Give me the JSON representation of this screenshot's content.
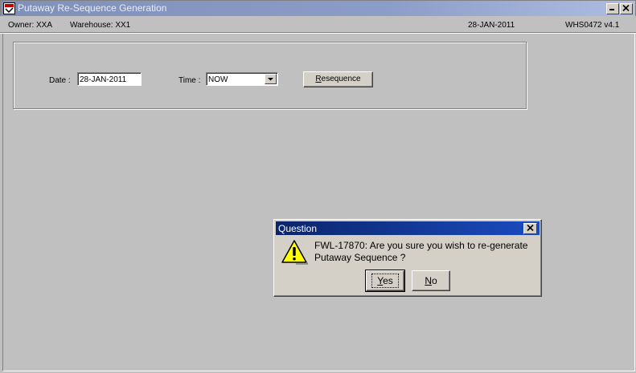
{
  "window": {
    "title": "Putaway Re-Sequence Generation"
  },
  "infobar": {
    "owner": "Owner:  XXA",
    "warehouse": "Warehouse:  XX1",
    "date": "28-JAN-2011",
    "version": "WHS0472  v4.1"
  },
  "form": {
    "date_label": "Date :",
    "date_value": "28-JAN-2011",
    "time_label": "Time :",
    "time_value": "NOW",
    "resequence_first": "R",
    "resequence_rest": "esequence"
  },
  "dialog": {
    "title": "Question",
    "message_line1": "FWL-17870:  Are you sure you wish to re-generate",
    "message_line2": "Putaway Sequence ?",
    "yes_first": "Y",
    "yes_rest": "es",
    "no_first": "N",
    "no_rest": "o"
  },
  "colors": {
    "dialog_title_bg": "#0a246a",
    "window_bg": "#c0c0c0"
  },
  "icons": {
    "app": "app-icon",
    "minimize": "minimize-icon",
    "close": "close-icon",
    "warning": "warning-icon",
    "dropdown": "chevron-down-icon"
  }
}
